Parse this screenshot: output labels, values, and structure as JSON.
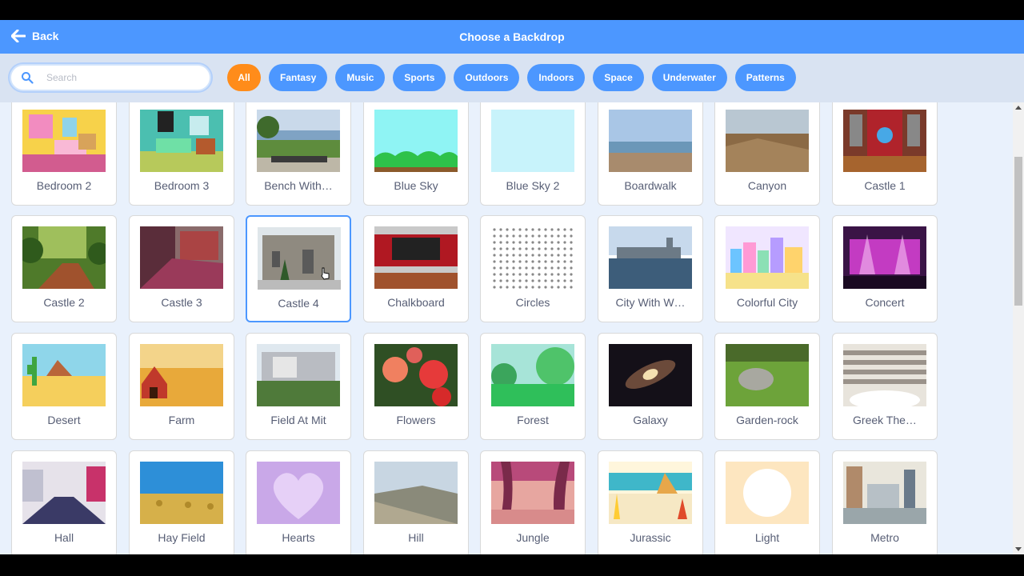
{
  "header": {
    "back_label": "Back",
    "title": "Choose a Backdrop"
  },
  "search": {
    "placeholder": "Search"
  },
  "tags": [
    "All",
    "Fantasy",
    "Music",
    "Sports",
    "Outdoors",
    "Indoors",
    "Space",
    "Underwater",
    "Patterns"
  ],
  "active_tag": "All",
  "colors": {
    "accent": "#4c97ff",
    "active_tag": "#ff8c1a",
    "grid_bg": "#e9f1fc",
    "label_text": "#575e75"
  },
  "backdrops": [
    "Bedroom 2",
    "Bedroom 3",
    "Bench With…",
    "Blue Sky",
    "Blue Sky 2",
    "Boardwalk",
    "Canyon",
    "Castle 1",
    "Castle 2",
    "Castle 3",
    "Castle 4",
    "Chalkboard",
    "Circles",
    "City With W…",
    "Colorful City",
    "Concert",
    "Desert",
    "Farm",
    "Field At Mit",
    "Flowers",
    "Forest",
    "Galaxy",
    "Garden-rock",
    "Greek The…",
    "Hall",
    "Hay Field",
    "Hearts",
    "Hill",
    "Jungle",
    "Jurassic",
    "Light",
    "Metro"
  ],
  "selected_backdrop": "Castle 4"
}
